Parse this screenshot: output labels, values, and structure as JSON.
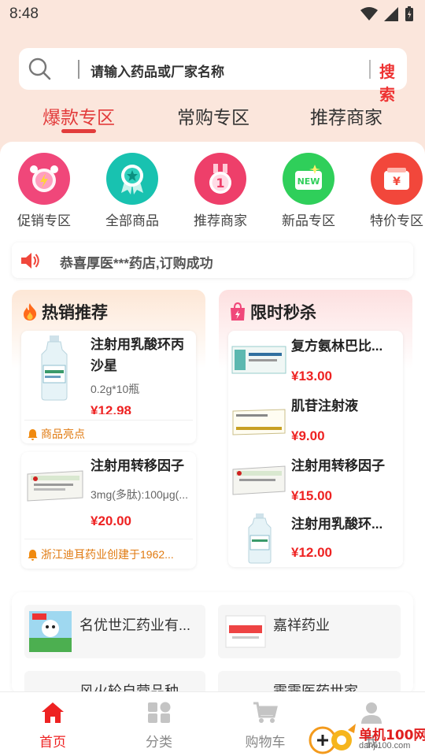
{
  "status": {
    "time": "8:48"
  },
  "search": {
    "placeholder": "请输入药品或厂家名称",
    "button": "搜索"
  },
  "tabs": [
    {
      "label": "爆款专区"
    },
    {
      "label": "常购专区"
    },
    {
      "label": "推荐商家"
    }
  ],
  "categories": [
    {
      "label": "促销专区",
      "icon": "alarm-clock-icon",
      "color": "#f0477a"
    },
    {
      "label": "全部商品",
      "icon": "medal-star-icon",
      "color": "#18c2b0"
    },
    {
      "label": "推荐商家",
      "icon": "ribbon-medal-icon",
      "color": "#ee3f6a"
    },
    {
      "label": "新品专区",
      "icon": "new-badge-icon",
      "color": "#2fcf5a"
    },
    {
      "label": "特价专区",
      "icon": "coupon-yen-icon",
      "color": "#f2473b"
    }
  ],
  "notice": {
    "text": "恭喜厚医***药店,订购成功"
  },
  "hot": {
    "title": "热销推荐",
    "items": [
      {
        "name": "注射用乳酸环丙沙星",
        "spec": "0.2g*10瓶",
        "price": "¥12.98",
        "highlight": "商品亮点"
      },
      {
        "name": "注射用转移因子",
        "spec": "3mg(多肽):100μg(...",
        "price": "¥20.00",
        "highlight": "浙江迪耳药业创建于1962..."
      }
    ]
  },
  "flash": {
    "title": "限时秒杀",
    "items": [
      {
        "name": "复方氨林巴比...",
        "price": "¥13.00"
      },
      {
        "name": "肌苷注射液",
        "price": "¥9.00"
      },
      {
        "name": "注射用转移因子",
        "price": "¥15.00"
      },
      {
        "name": "注射用乳酸环...",
        "price": "¥12.00"
      }
    ]
  },
  "suppliers": [
    {
      "name": "名优世汇药业有..."
    },
    {
      "name": "嘉祥药业"
    },
    {
      "name": "风火轮自营品种"
    },
    {
      "name": "霁霁医药世家"
    }
  ],
  "nav": [
    {
      "label": "首页"
    },
    {
      "label": "分类"
    },
    {
      "label": "购物车"
    },
    {
      "label": "我"
    }
  ],
  "watermark": {
    "text": "单机100网",
    "url": "danji100.com"
  },
  "colors": {
    "accent": "#e23c3c",
    "header_bg": "#fbe6dc",
    "highlight": "#e07a10"
  }
}
